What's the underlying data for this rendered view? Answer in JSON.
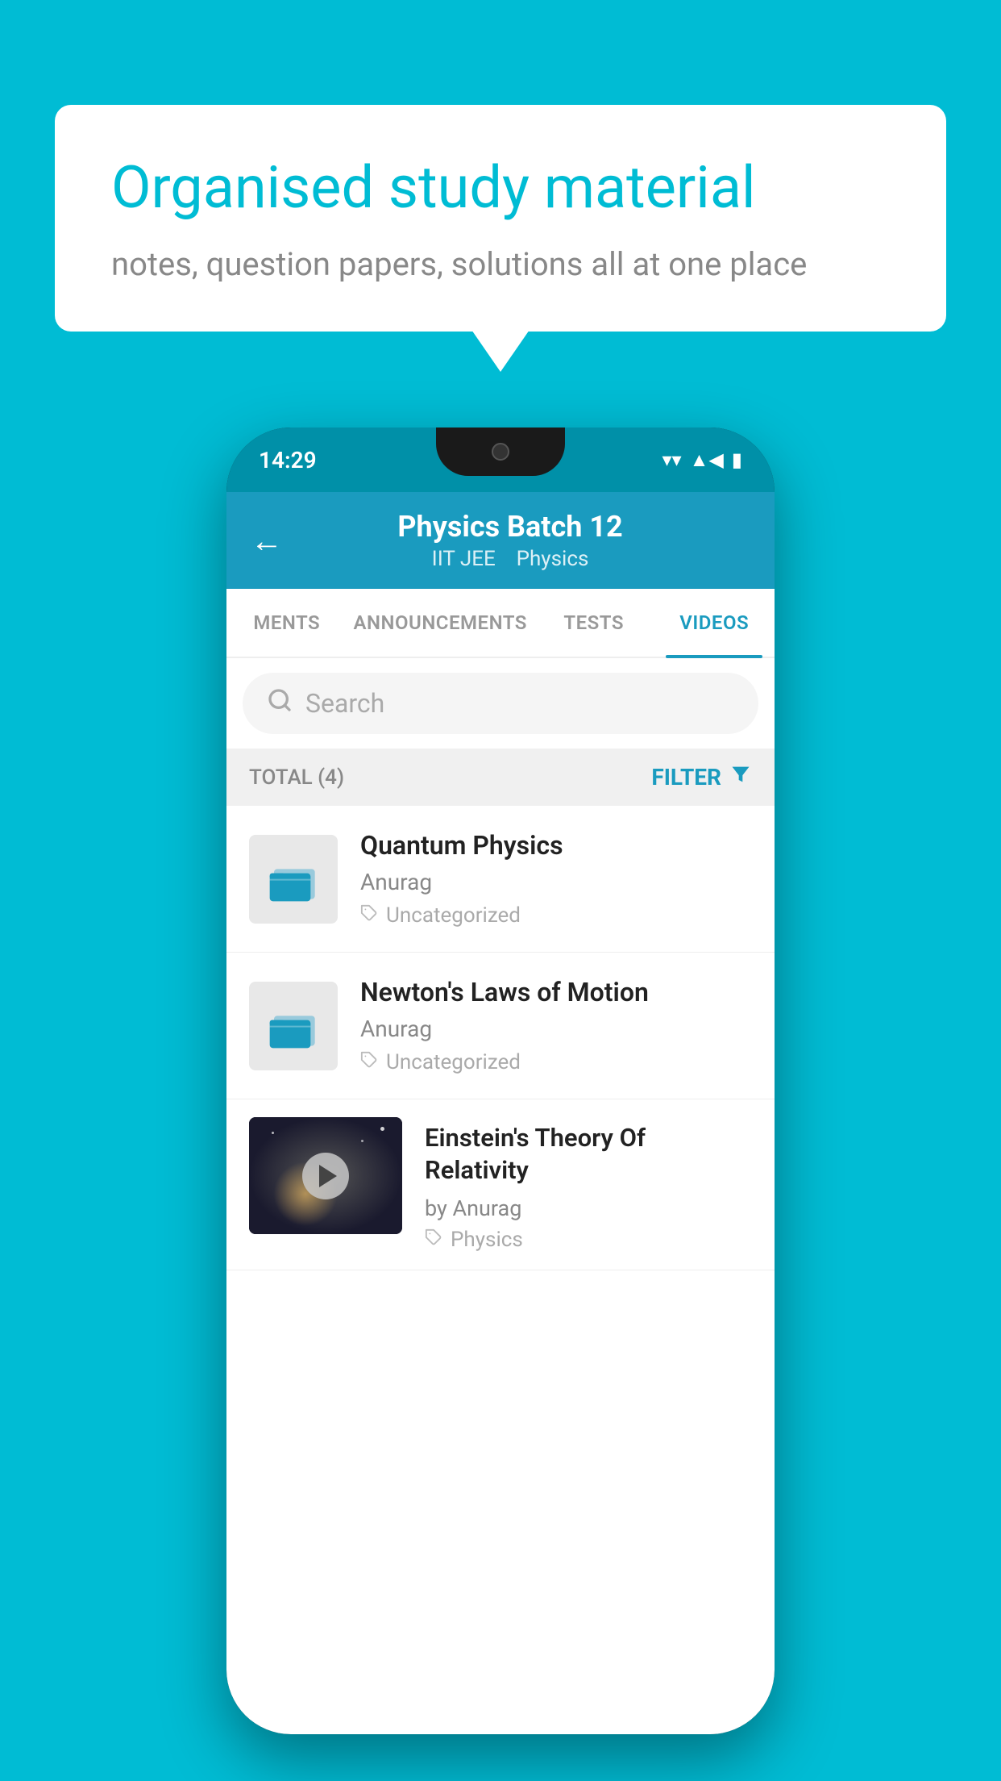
{
  "background_color": "#00bcd4",
  "bubble": {
    "title": "Organised study material",
    "subtitle": "notes, question papers, solutions all at one place"
  },
  "status_bar": {
    "time": "14:29",
    "wifi_icon": "▼",
    "signal_icon": "▲",
    "battery_icon": "▮"
  },
  "header": {
    "back_label": "←",
    "title": "Physics Batch 12",
    "subtitle_part1": "IIT JEE",
    "subtitle_part2": "Physics"
  },
  "tabs": [
    {
      "label": "MENTS",
      "active": false
    },
    {
      "label": "ANNOUNCEMENTS",
      "active": false
    },
    {
      "label": "TESTS",
      "active": false
    },
    {
      "label": "VIDEOS",
      "active": true
    }
  ],
  "search": {
    "placeholder": "Search"
  },
  "filter": {
    "total_label": "TOTAL (4)",
    "filter_label": "FILTER"
  },
  "videos": [
    {
      "title": "Quantum Physics",
      "author": "Anurag",
      "tag": "Uncategorized",
      "type": "folder"
    },
    {
      "title": "Newton's Laws of Motion",
      "author": "Anurag",
      "tag": "Uncategorized",
      "type": "folder"
    },
    {
      "title": "Einstein's Theory Of Relativity",
      "author": "by Anurag",
      "tag": "Physics",
      "type": "video"
    }
  ]
}
